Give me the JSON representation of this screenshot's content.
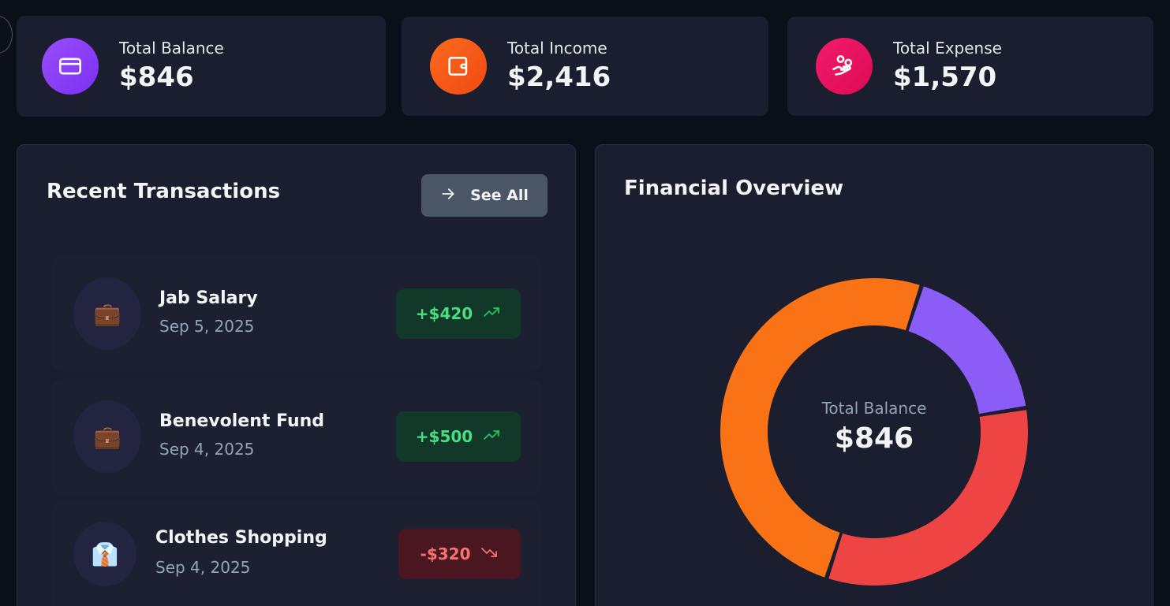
{
  "stats": [
    {
      "label": "Total Balance",
      "value": "$846",
      "icon": "card-icon",
      "color": "#8b3dff"
    },
    {
      "label": "Total Income",
      "value": "$2,416",
      "icon": "wallet-icon",
      "color": "#f7591a"
    },
    {
      "label": "Total Expense",
      "value": "$1,570",
      "icon": "hand-coins-icon",
      "color": "#ee1462"
    }
  ],
  "transactions_panel": {
    "title": "Recent Transactions",
    "see_all_label": "See All",
    "items": [
      {
        "name": "Jab Salary",
        "date": "Sep 5, 2025",
        "amount": "+$420",
        "type": "income",
        "emoji": "💼"
      },
      {
        "name": "Benevolent Fund",
        "date": "Sep 4, 2025",
        "amount": "+$500",
        "type": "income",
        "emoji": "💼"
      },
      {
        "name": "Clothes Shopping",
        "date": "Sep 4, 2025",
        "amount": "-$320",
        "type": "expense",
        "emoji": "👔"
      }
    ]
  },
  "overview_panel": {
    "title": "Financial Overview",
    "center_label": "Total Balance",
    "center_value": "$846"
  },
  "chart_data": {
    "type": "pie",
    "categories": [
      "Total Balance",
      "Total Expense",
      "Total Income"
    ],
    "values": [
      846,
      1570,
      2416
    ],
    "colors": [
      "#8b5cf6",
      "#ef4444",
      "#f97316"
    ]
  },
  "colors": {
    "background": "#0b0f1a",
    "card": "#1b1e2e",
    "income_text": "#4ade80",
    "expense_text": "#f87171"
  }
}
